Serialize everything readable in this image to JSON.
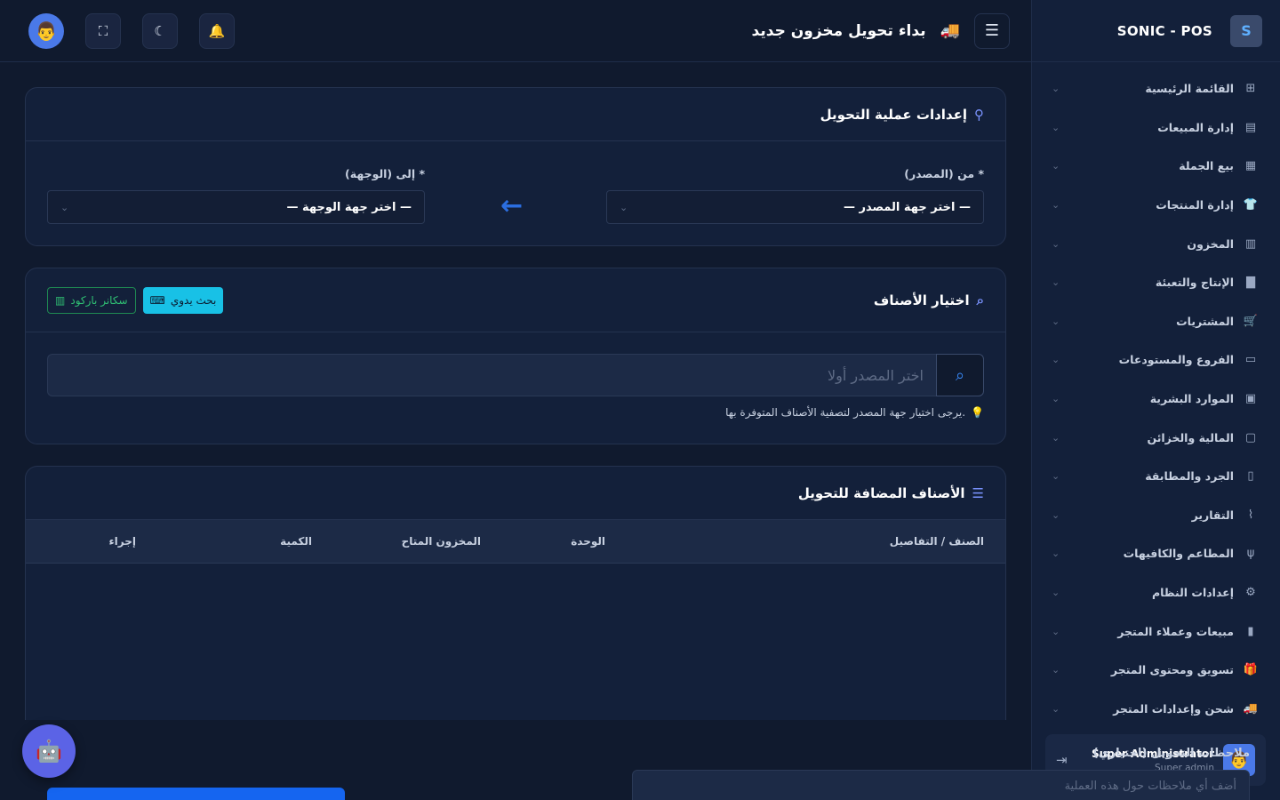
{
  "brand": {
    "name": "SONIC - POS",
    "logo": "S"
  },
  "header": {
    "title": "بداء تحويل مخزون جديد",
    "icons": {
      "menu": "☰",
      "truck": "🚚",
      "bell": "🔔",
      "moon": "☾",
      "fullscreen": "⛶",
      "avatar": "👨"
    }
  },
  "sidebar": {
    "items": [
      {
        "label": "القائمة الرئيسية",
        "icon": "⊞"
      },
      {
        "label": "إدارة المبيعات",
        "icon": "▤"
      },
      {
        "label": "بيع الجملة",
        "icon": "▦"
      },
      {
        "label": "إدارة المنتجات",
        "icon": "👕"
      },
      {
        "label": "المخزون",
        "icon": "▥"
      },
      {
        "label": "الإنتاج والتعبئة",
        "icon": "▇"
      },
      {
        "label": "المشتريات",
        "icon": "🛒"
      },
      {
        "label": "الفروع والمستودعات",
        "icon": "▭"
      },
      {
        "label": "الموارد البشرية",
        "icon": "▣"
      },
      {
        "label": "المالية والخزائن",
        "icon": "▢"
      },
      {
        "label": "الجرد والمطابقة",
        "icon": "▯"
      },
      {
        "label": "التقارير",
        "icon": "⌇"
      },
      {
        "label": "المطاعم والكافيهات",
        "icon": "ψ"
      },
      {
        "label": "إعدادات النظام",
        "icon": "⚙"
      },
      {
        "label": "مبيعات وعملاء المتجر",
        "icon": "▮"
      },
      {
        "label": "تسويق ومحتوى المتجر",
        "icon": "🎁"
      },
      {
        "label": "شحن وإعدادات المتجر",
        "icon": "🚚"
      }
    ],
    "user": {
      "name": "Super Administrator",
      "role": "Super admin",
      "avatar": "👨",
      "logout_icon": "⇥"
    }
  },
  "transfer_settings": {
    "title": "إعدادات عملية التحويل",
    "icon": "⚲",
    "from_label": "من (المصدر) *",
    "from_value": "— اختر جهة المصدر —",
    "to_label": "إلى (الوجهة) *",
    "to_value": "— اختر جهة الوجهة —",
    "arrow": "←"
  },
  "items_select": {
    "title": "اختيار الأصناف",
    "icon": "⌕",
    "manual_btn": "بحث يدوي",
    "manual_icon": "⌨",
    "scan_btn": "سكانر باركود",
    "scan_icon": "▥",
    "search_placeholder": "اختر المصدر أولا",
    "search_icon": "⌕",
    "hint": "يرجى اختيار جهة المصدر لتصفية الأصناف المتوفرة بها.",
    "hint_icon": "💡"
  },
  "added_items": {
    "title": "الأصناف المضافة للتحويل",
    "icon": "☰",
    "columns": [
      "الصنف / التفاصيل",
      "الوحدة",
      "المخزون المتاح",
      "الكمية",
      "إجراء"
    ]
  },
  "notes": {
    "label": "ملاحظات التحويل (اختياري)",
    "placeholder": "أضف أي ملاحظات حول هذه العملية"
  },
  "robot_icon": "🤖"
}
